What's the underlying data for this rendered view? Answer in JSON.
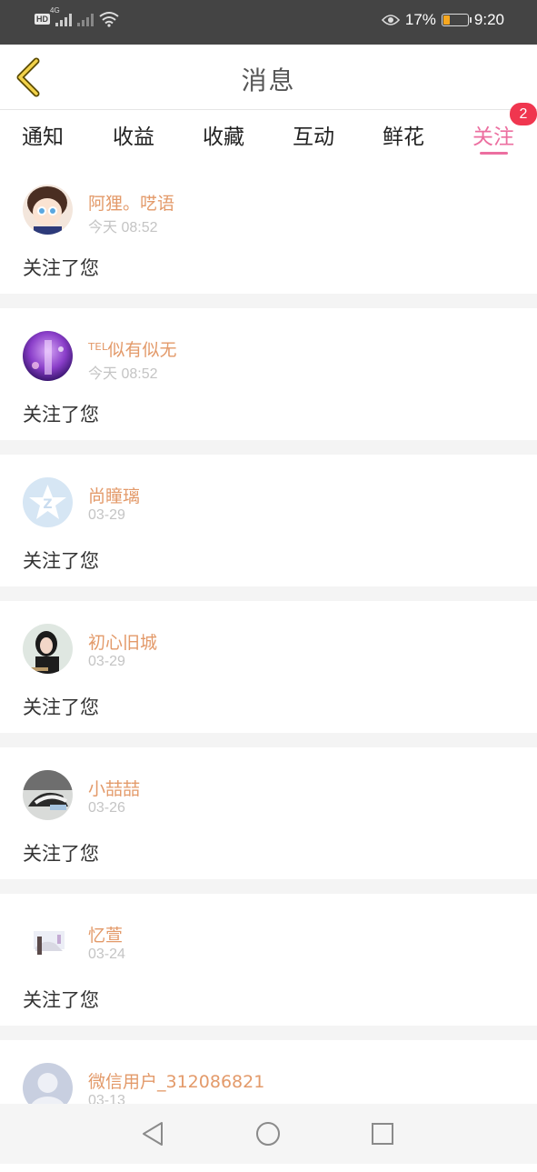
{
  "status_bar": {
    "network": "4G",
    "battery": "17%",
    "time": "9:20"
  },
  "header": {
    "title": "消息"
  },
  "tabs": [
    {
      "label": "通知"
    },
    {
      "label": "收益"
    },
    {
      "label": "收藏"
    },
    {
      "label": "互动"
    },
    {
      "label": "鲜花"
    },
    {
      "label": "关注"
    }
  ],
  "active_tab": "关注",
  "badge": "2",
  "accent_color": "#ec6fa0",
  "name_color": "#e39a6a",
  "items": [
    {
      "name": "阿狸。呓语",
      "time": "今天 08:52",
      "message": "关注了您"
    },
    {
      "name": "ᵀᴱᴸ似有似无",
      "time": "今天 08:52",
      "message": "关注了您"
    },
    {
      "name": "尚瞳璃",
      "time": "03-29",
      "message": "关注了您"
    },
    {
      "name": "初心旧城",
      "time": "03-29",
      "message": "关注了您"
    },
    {
      "name": "小喆喆",
      "time": "03-26",
      "message": "关注了您"
    },
    {
      "name": "忆萱",
      "time": "03-24",
      "message": "关注了您"
    },
    {
      "name": "微信用户_312086821",
      "time": "03-13"
    }
  ]
}
